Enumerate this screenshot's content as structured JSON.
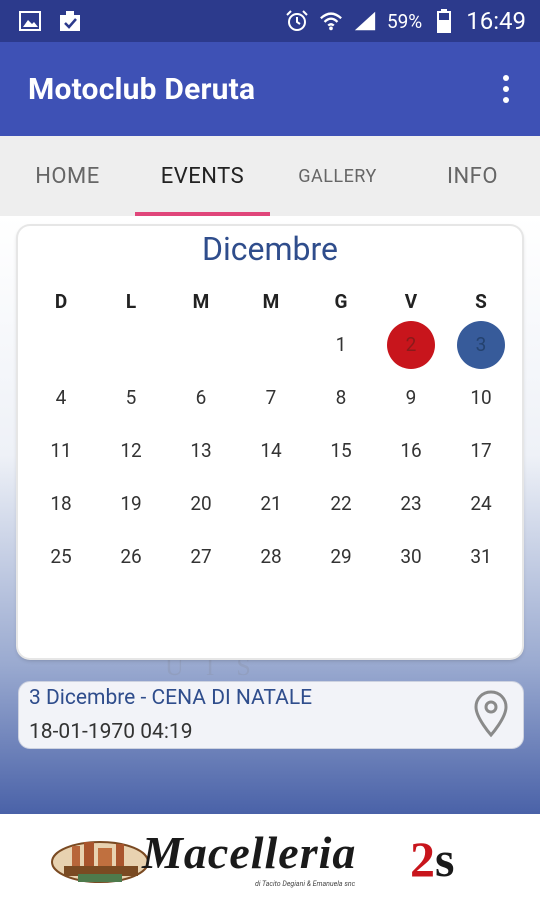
{
  "status_bar": {
    "battery": "59%",
    "time": "16:49"
  },
  "appbar": {
    "title": "Motoclub Deruta"
  },
  "tabs": [
    {
      "label": "HOME",
      "active": false
    },
    {
      "label": "EVENTS",
      "active": true
    },
    {
      "label": "GALLERY",
      "active": false
    },
    {
      "label": "INFO",
      "active": false
    }
  ],
  "calendar": {
    "month": "Dicembre",
    "weekdays": [
      "D",
      "L",
      "M",
      "M",
      "G",
      "V",
      "S"
    ],
    "weeks": [
      [
        "",
        "",
        "",
        "",
        "1",
        "2",
        "3"
      ],
      [
        "4",
        "5",
        "6",
        "7",
        "8",
        "9",
        "10"
      ],
      [
        "11",
        "12",
        "13",
        "14",
        "15",
        "16",
        "17"
      ],
      [
        "18",
        "19",
        "20",
        "21",
        "22",
        "23",
        "24"
      ],
      [
        "25",
        "26",
        "27",
        "28",
        "29",
        "30",
        "31"
      ]
    ],
    "highlights": {
      "2": "red",
      "3": "blue"
    },
    "highlight_colors": {
      "red": "#c8151c",
      "blue": "#375b9a"
    }
  },
  "event": {
    "title": "3 Dicembre - CENA DI NATALE",
    "datetime": "18-01-1970 04:19",
    "icon": "location-pin-icon"
  },
  "banner": {
    "brand": "Macelleria",
    "brand_suffix_2": "2",
    "brand_suffix_s": "s",
    "tagline": "di Tacito Degiani & Emanuela snc",
    "badge": "DUE ESSE"
  },
  "colors": {
    "statusbar": "#2c3a8c",
    "appbar": "#3e51b5",
    "tab_indicator": "#e0467a",
    "month_text": "#2f4d8c"
  }
}
